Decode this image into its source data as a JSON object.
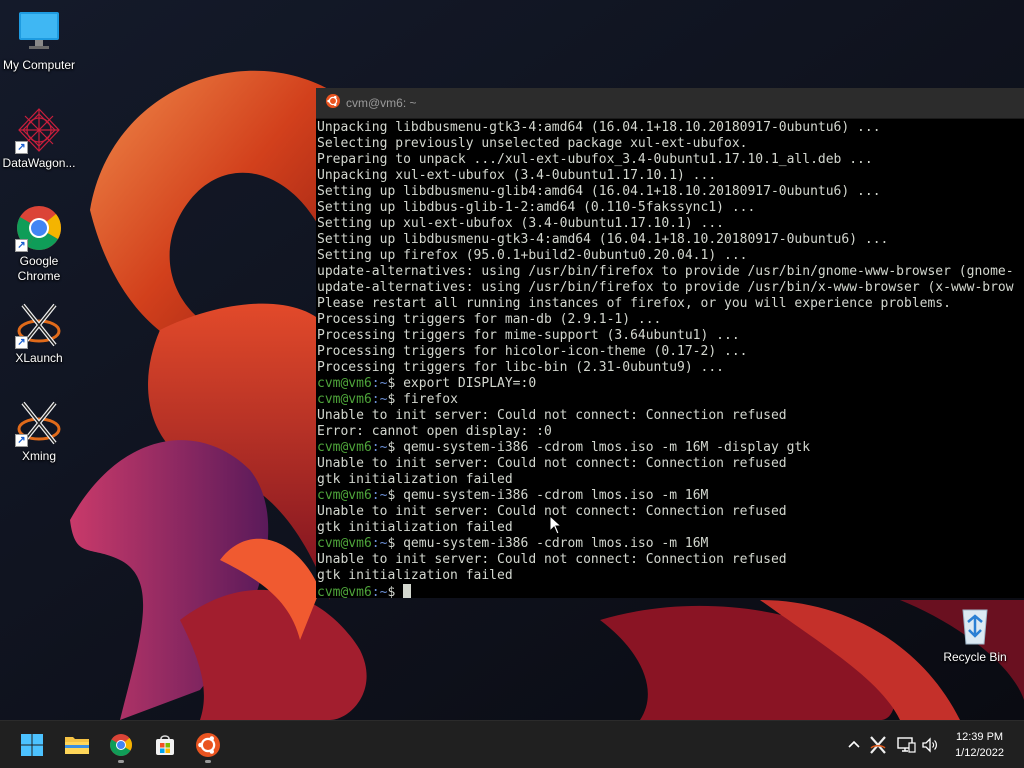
{
  "desktop": {
    "icons": [
      {
        "label": "My Computer",
        "icon": "monitor-icon"
      },
      {
        "label": "DataWagon...",
        "icon": "datawagon-icon"
      },
      {
        "label": "Google Chrome",
        "icon": "chrome-icon"
      },
      {
        "label": "XLaunch",
        "icon": "x-icon"
      },
      {
        "label": "Xming",
        "icon": "x-icon"
      }
    ],
    "recycle_bin": {
      "label": "Recycle Bin",
      "icon": "recycle-bin-icon"
    }
  },
  "terminal": {
    "title": "cvm@vm6: ~",
    "prompt_user": "cvm@vm6",
    "prompt_path": ":~",
    "lines": [
      {
        "type": "out",
        "text": "Unpacking libdbusmenu-gtk3-4:amd64 (16.04.1+18.10.20180917-0ubuntu6) ..."
      },
      {
        "type": "out",
        "text": "Selecting previously unselected package xul-ext-ubufox."
      },
      {
        "type": "out",
        "text": "Preparing to unpack .../xul-ext-ubufox_3.4-0ubuntu1.17.10.1_all.deb ..."
      },
      {
        "type": "out",
        "text": "Unpacking xul-ext-ubufox (3.4-0ubuntu1.17.10.1) ..."
      },
      {
        "type": "out",
        "text": "Setting up libdbusmenu-glib4:amd64 (16.04.1+18.10.20180917-0ubuntu6) ..."
      },
      {
        "type": "out",
        "text": "Setting up libdbus-glib-1-2:amd64 (0.110-5fakssync1) ..."
      },
      {
        "type": "out",
        "text": "Setting up xul-ext-ubufox (3.4-0ubuntu1.17.10.1) ..."
      },
      {
        "type": "out",
        "text": "Setting up libdbusmenu-gtk3-4:amd64 (16.04.1+18.10.20180917-0ubuntu6) ..."
      },
      {
        "type": "out",
        "text": "Setting up firefox (95.0.1+build2-0ubuntu0.20.04.1) ..."
      },
      {
        "type": "out",
        "text": "update-alternatives: using /usr/bin/firefox to provide /usr/bin/gnome-www-browser (gnome-"
      },
      {
        "type": "out",
        "text": "update-alternatives: using /usr/bin/firefox to provide /usr/bin/x-www-browser (x-www-brow"
      },
      {
        "type": "out",
        "text": "Please restart all running instances of firefox, or you will experience problems."
      },
      {
        "type": "out",
        "text": "Processing triggers for man-db (2.9.1-1) ..."
      },
      {
        "type": "out",
        "text": "Processing triggers for mime-support (3.64ubuntu1) ..."
      },
      {
        "type": "out",
        "text": "Processing triggers for hicolor-icon-theme (0.17-2) ..."
      },
      {
        "type": "out",
        "text": "Processing triggers for libc-bin (2.31-0ubuntu9) ..."
      },
      {
        "type": "cmd",
        "text": "$ export DISPLAY=:0"
      },
      {
        "type": "cmd",
        "text": "$ firefox"
      },
      {
        "type": "out",
        "text": "Unable to init server: Could not connect: Connection refused"
      },
      {
        "type": "out",
        "text": "Error: cannot open display: :0"
      },
      {
        "type": "cmd",
        "text": "$ qemu-system-i386 -cdrom lmos.iso -m 16M -display gtk"
      },
      {
        "type": "out",
        "text": "Unable to init server: Could not connect: Connection refused"
      },
      {
        "type": "out",
        "text": "gtk initialization failed"
      },
      {
        "type": "cmd",
        "text": "$ qemu-system-i386 -cdrom lmos.iso -m 16M"
      },
      {
        "type": "out",
        "text": "Unable to init server: Could not connect: Connection refused"
      },
      {
        "type": "out",
        "text": "gtk initialization failed"
      },
      {
        "type": "cmd",
        "text": "$ qemu-system-i386 -cdrom lmos.iso -m 16M"
      },
      {
        "type": "out",
        "text": "Unable to init server: Could not connect: Connection refused"
      },
      {
        "type": "out",
        "text": "gtk initialization failed"
      },
      {
        "type": "cmd",
        "text": "$ ",
        "cursor": true
      }
    ]
  },
  "taskbar": {
    "pinned": [
      {
        "name": "start-button",
        "icon": "windows-logo-icon"
      },
      {
        "name": "file-explorer-button",
        "icon": "folder-icon"
      },
      {
        "name": "chrome-button",
        "icon": "chrome-icon"
      },
      {
        "name": "store-button",
        "icon": "store-icon"
      },
      {
        "name": "ubuntu-button",
        "icon": "ubuntu-icon"
      }
    ],
    "clock": {
      "time": "12:39 PM",
      "date": "1/12/2022"
    }
  },
  "colors": {
    "prompt_user": "#4ea43a",
    "prompt_path": "#6b8fd4",
    "terminal_text": "#d3d7cf",
    "terminal_bg": "#000000",
    "ubuntu_orange": "#e95420",
    "taskbar_bg": "#202020"
  }
}
